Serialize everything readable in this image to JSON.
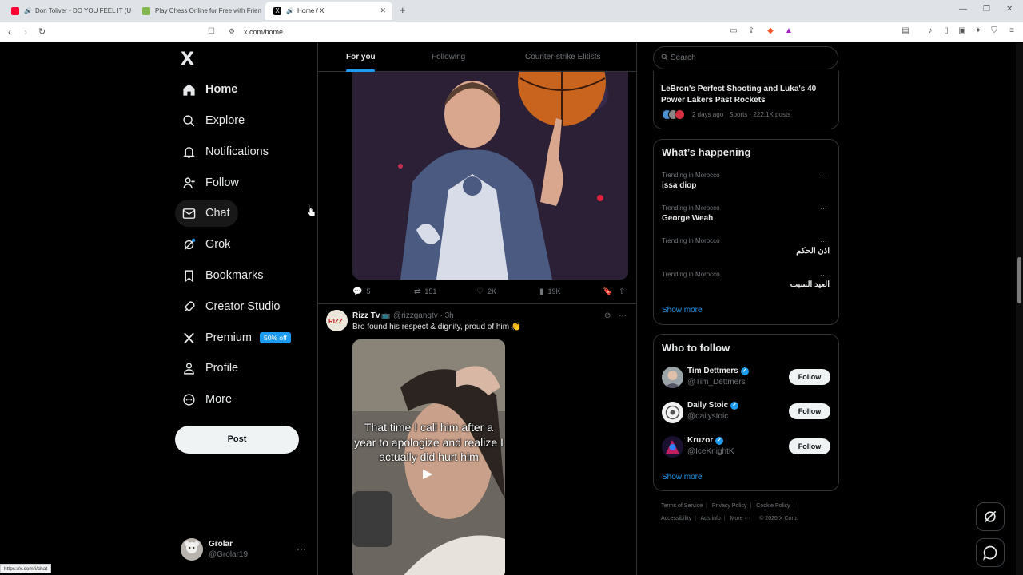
{
  "browser": {
    "tabs": [
      {
        "title": "Don Toliver - DO YOU FEEL IT (U",
        "favicon_color": "#ff0033"
      },
      {
        "title": "Play Chess Online for Free with Frien",
        "favicon_color": "#81b64c"
      },
      {
        "title": "Home / X",
        "favicon_color": "#000000"
      }
    ],
    "url": "x.com/home",
    "status_url": "https://x.com/i/chat"
  },
  "sidebar": {
    "logo": "X",
    "items": [
      {
        "label": "Home",
        "icon": "home-icon"
      },
      {
        "label": "Explore",
        "icon": "search-icon"
      },
      {
        "label": "Notifications",
        "icon": "bell-icon"
      },
      {
        "label": "Follow",
        "icon": "person-add-icon"
      },
      {
        "label": "Chat",
        "icon": "mail-icon"
      },
      {
        "label": "Grok",
        "icon": "grok-icon"
      },
      {
        "label": "Bookmarks",
        "icon": "bookmark-icon"
      },
      {
        "label": "Creator Studio",
        "icon": "rocket-icon"
      },
      {
        "label": "Premium",
        "icon": "x-icon",
        "badge": "50% off"
      },
      {
        "label": "Profile",
        "icon": "person-icon"
      },
      {
        "label": "More",
        "icon": "more-circle-icon"
      }
    ],
    "post_label": "Post",
    "account": {
      "name": "Grolar",
      "handle": "@Grolar19"
    }
  },
  "feed": {
    "tabs": [
      "For you",
      "Following",
      "Counter-strike Elitists"
    ],
    "first_post_stats": {
      "replies": "5",
      "reposts": "151",
      "likes": "2K",
      "views": "19K"
    },
    "tweet": {
      "name": "Rizz Tv",
      "handle": "@rizzgangtv · 3h",
      "text": "Bro found his respect & dignity, proud of him 👏",
      "video_caption": "That time I call him after a year to apologize and realize  I actually did hurt him"
    }
  },
  "right": {
    "search_placeholder": "Search",
    "news": {
      "title": "LeBron's Perfect Shooting and Luka's 40 Power Lakers Past Rockets",
      "meta": "2 days ago · Sports · 222.1K posts"
    },
    "happening": {
      "title": "What’s happening",
      "trends": [
        {
          "meta": "Trending in Morocco",
          "name": "issa diop"
        },
        {
          "meta": "Trending in Morocco",
          "name": "George Weah"
        },
        {
          "meta": "Trending in Morocco",
          "name": "اذن الحكم"
        },
        {
          "meta": "Trending in Morocco",
          "name": "العيد السبت"
        }
      ],
      "show_more": "Show more"
    },
    "who_to_follow": {
      "title": "Who to follow",
      "users": [
        {
          "name": "Tim Dettmers",
          "handle": "@Tim_Dettmers",
          "button": "Follow"
        },
        {
          "name": "Daily Stoic",
          "handle": "@dailystoic",
          "button": "Follow"
        },
        {
          "name": "Kruzor",
          "handle": "@IceKnightK",
          "button": "Follow"
        }
      ],
      "show_more": "Show more"
    },
    "footer": {
      "row1": [
        "Terms of Service",
        "Privacy Policy",
        "Cookie Policy"
      ],
      "row2": [
        "Accessibility",
        "Ads info",
        "More ···",
        "© 2026 X Corp."
      ]
    }
  },
  "colors": {
    "accent": "#1d9bf0",
    "background": "#000000",
    "border": "#2f3336"
  }
}
